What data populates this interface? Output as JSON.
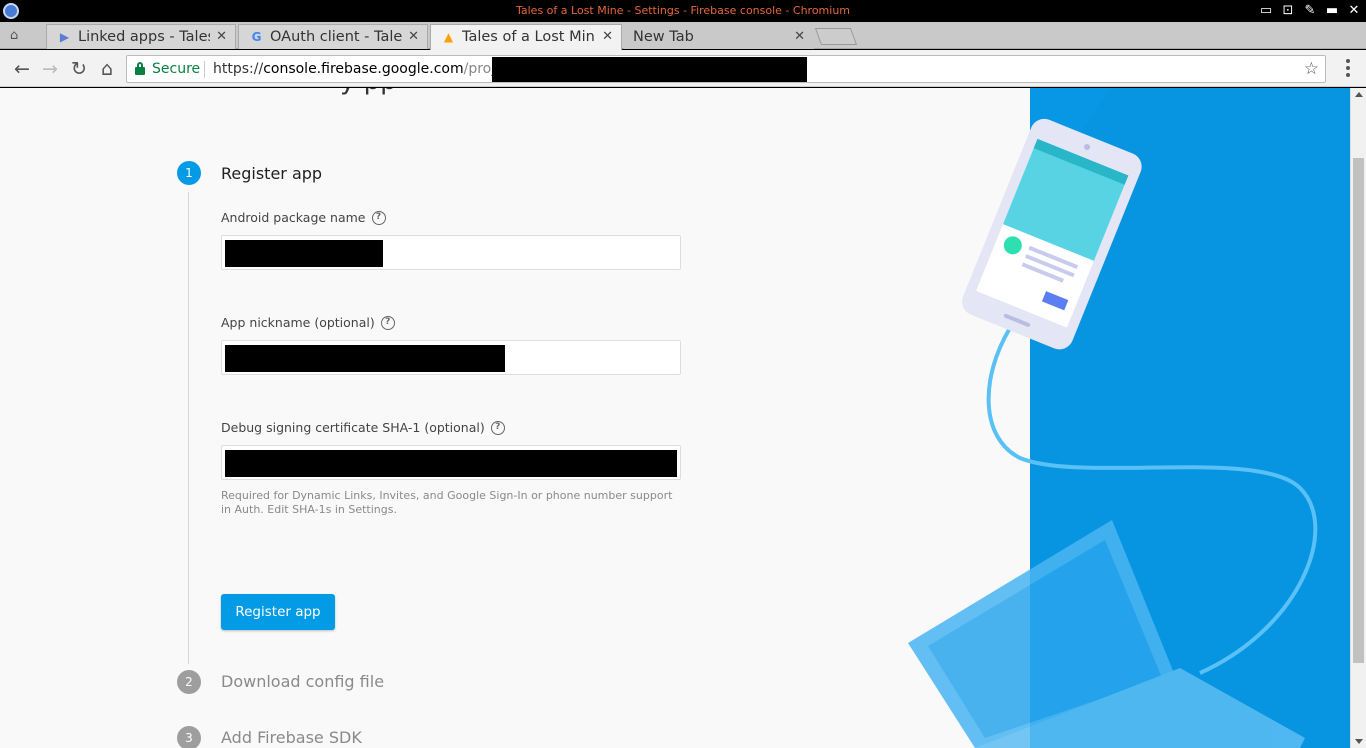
{
  "window": {
    "title": "Tales of a Lost Mine - Settings - Firebase console - Chromium"
  },
  "tabs": [
    {
      "label": "Linked apps - Tales",
      "icon": "play-console-icon",
      "active": false
    },
    {
      "label": "OAuth client - Tales",
      "icon": "google-g-icon",
      "active": false
    },
    {
      "label": "Tales of a Lost Mine",
      "icon": "firebase-flame-icon",
      "active": true
    },
    {
      "label": "New Tab",
      "icon": "",
      "active": false
    }
  ],
  "toolbar": {
    "secure_label": "Secure",
    "url_scheme": "https://",
    "url_host": "console.firebase.google.com",
    "url_path": "/project"
  },
  "page": {
    "heading_fragment": "y            pp"
  },
  "steps": [
    {
      "number": "1",
      "title": "Register app",
      "state": "active"
    },
    {
      "number": "2",
      "title": "Download config file",
      "state": "inactive"
    },
    {
      "number": "3",
      "title": "Add Firebase SDK",
      "state": "inactive"
    }
  ],
  "form": {
    "package_name_label": "Android package name",
    "nickname_label": "App nickname (optional)",
    "sha1_label": "Debug signing certificate SHA-1 (optional)",
    "sha1_hint": "Required for Dynamic Links, Invites, and Google Sign-In or phone number support in Auth. Edit SHA-1s in Settings.",
    "register_button": "Register app"
  },
  "colors": {
    "primary": "#039be5",
    "secure": "#0b8043",
    "title_text": "#e5673a",
    "illustration_bg": "#0591e0"
  }
}
